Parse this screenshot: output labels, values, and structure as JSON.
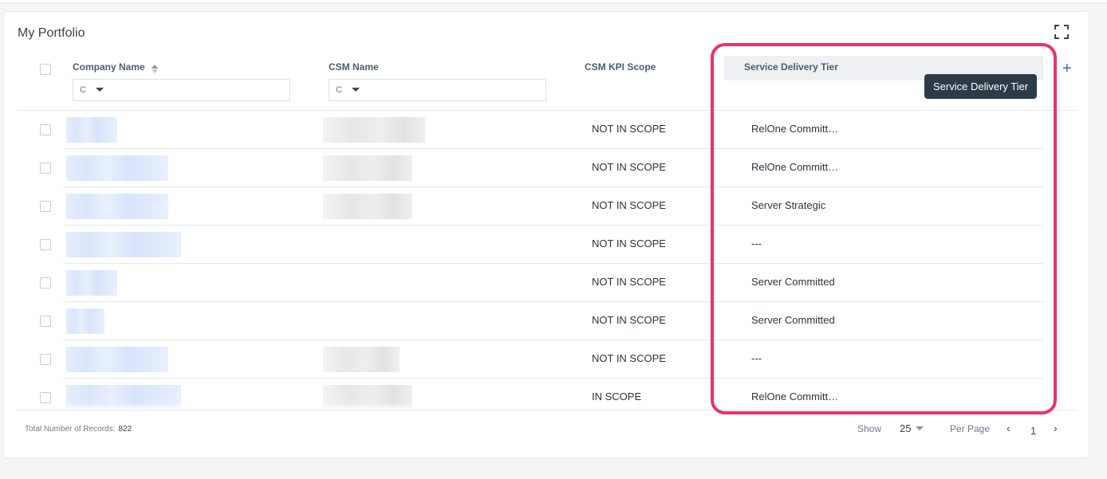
{
  "card": {
    "title": "My Portfolio"
  },
  "columns": {
    "company": "Company Name",
    "csm": "CSM Name",
    "kpi": "CSM KPI Scope",
    "sdt": "Service Delivery Tier"
  },
  "filters": {
    "company": "C",
    "csm": "C"
  },
  "tooltip": "Service Delivery Tier",
  "rows": [
    {
      "kpi": "NOT IN SCOPE",
      "sdt": "RelOne Committ…"
    },
    {
      "kpi": "NOT IN SCOPE",
      "sdt": "RelOne Committ…"
    },
    {
      "kpi": "NOT IN SCOPE",
      "sdt": "Server Strategic"
    },
    {
      "kpi": "NOT IN SCOPE",
      "sdt": "---"
    },
    {
      "kpi": "NOT IN SCOPE",
      "sdt": "Server Committed"
    },
    {
      "kpi": "NOT IN SCOPE",
      "sdt": "Server Committed"
    },
    {
      "kpi": "NOT IN SCOPE",
      "sdt": "---"
    },
    {
      "kpi": "IN SCOPE",
      "sdt": "RelOne Committ…"
    }
  ],
  "footer": {
    "total_label": "Total Number of Records:",
    "total_value": "822",
    "show_label": "Show",
    "per_page_value": "25",
    "per_page_label": "Per Page",
    "page": "1"
  },
  "colors": {
    "highlight": "#e8336b",
    "accent": "#2f6db5",
    "tooltip_bg": "#2e3a48"
  }
}
